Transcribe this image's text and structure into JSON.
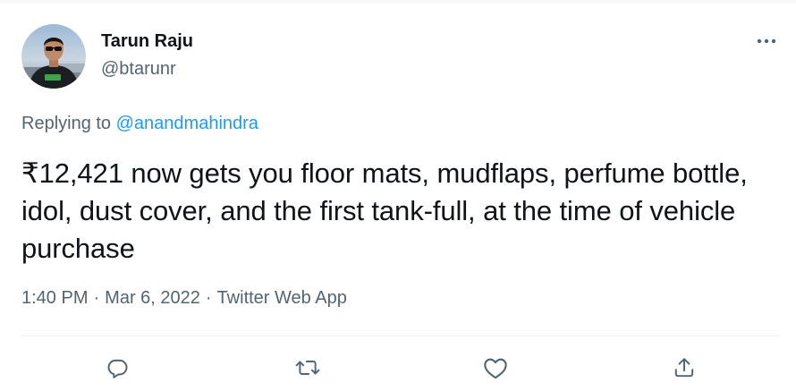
{
  "author": {
    "name": "Tarun Raju",
    "handle": "@btarunr"
  },
  "reply": {
    "prefix": "Replying to ",
    "mention": "@anandmahindra"
  },
  "tweet": {
    "text": "₹12,421 now gets you floor mats, mudflaps, perfume bottle, idol, dust cover, and the first tank-full, at the time of vehicle purchase"
  },
  "meta": {
    "time": "1:40 PM",
    "separator": "·",
    "date": "Mar 6, 2022",
    "source": "Twitter Web App"
  },
  "icons": {
    "more": "more-dots-icon",
    "reply": "comment-bubble-icon",
    "retweet": "retweet-arrows-icon",
    "like": "heart-icon",
    "share": "share-upload-icon"
  },
  "colors": {
    "text_primary": "#0f1419",
    "text_secondary": "#536471",
    "link": "#1d9bf0",
    "divider": "#eff3f4"
  }
}
